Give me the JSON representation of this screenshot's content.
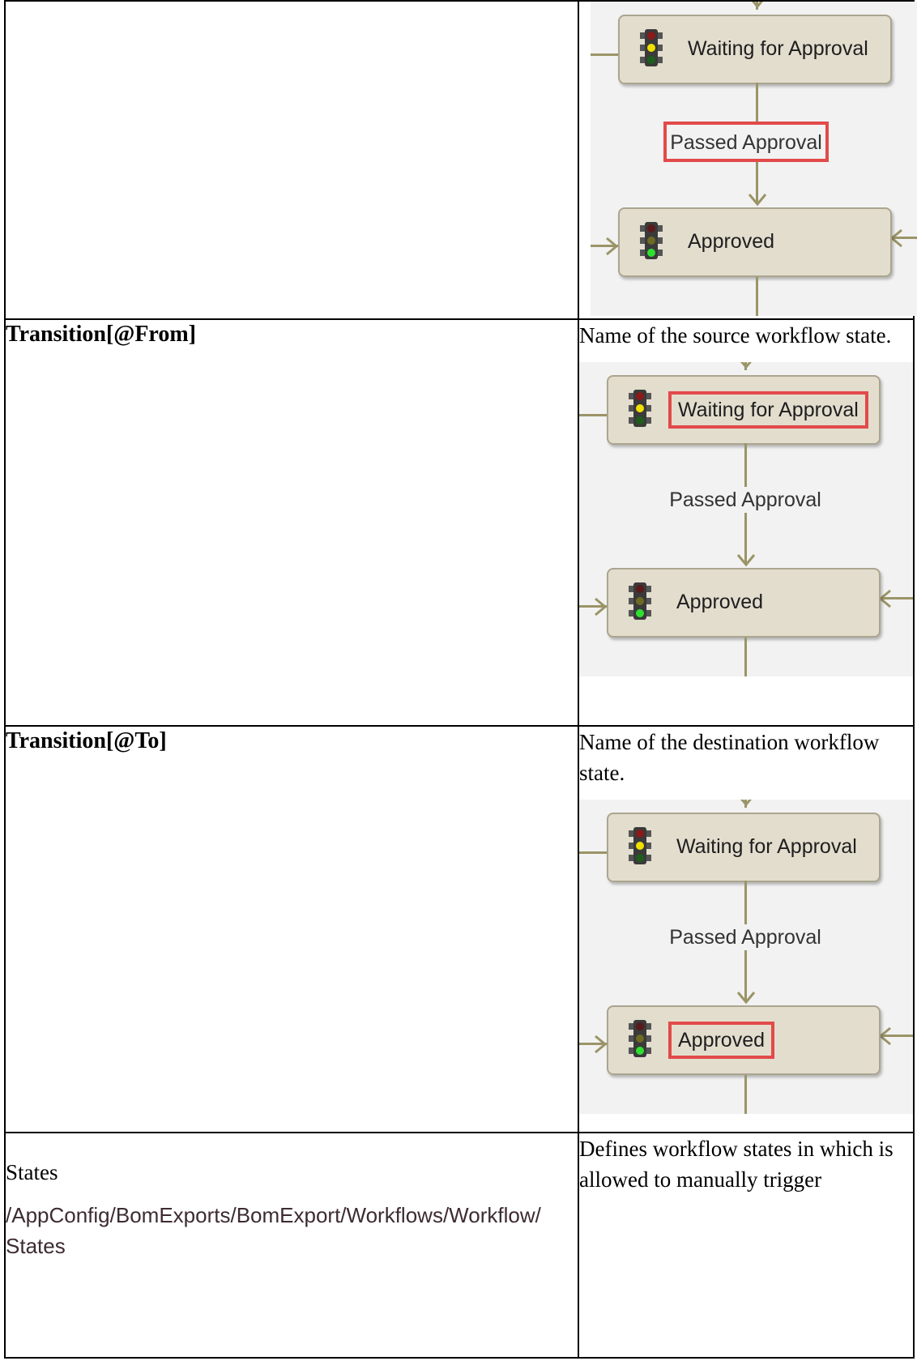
{
  "rows": [
    {
      "term": "",
      "description": "",
      "diagram": {
        "state_top": "Waiting for Approval",
        "transition": "Passed Approval",
        "state_bottom": "Approved",
        "highlight": "transition"
      }
    },
    {
      "term": "Transition[@From]",
      "description": "Name of the source workflow state.",
      "diagram": {
        "state_top": "Waiting for Approval",
        "transition": "Passed Approval",
        "state_bottom": "Approved",
        "highlight": "state_top"
      }
    },
    {
      "term": "Transition[@To]",
      "description": "Name of the destination workflow state.",
      "diagram": {
        "state_top": "Waiting for Approval",
        "transition": "Passed Approval",
        "state_bottom": "Approved",
        "highlight": "state_bottom"
      }
    },
    {
      "term": "States",
      "xpath": "/AppConfig/BomExports/BomExport/Workflows/Workflow/States",
      "description": "Defines workflow states in which is allowed to manually trigger"
    }
  ],
  "colors": {
    "connector": "#9b9467",
    "state_fill": "#e3ddce",
    "highlight_box": "#e24a4a",
    "diagram_bg": "#f2f2f2"
  },
  "icons": [
    "traffic-light-icon"
  ]
}
